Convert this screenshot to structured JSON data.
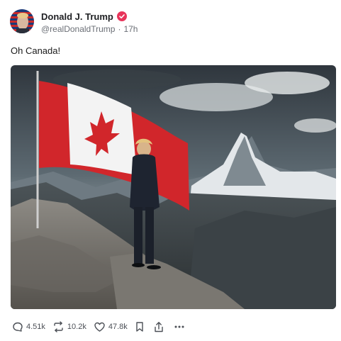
{
  "author": {
    "name": "Donald J. Trump",
    "handle": "@realDonaldTrump",
    "separator": "·",
    "time": "17h",
    "verified_color": "#e8345a"
  },
  "post": {
    "text": "Oh Canada!"
  },
  "image": {
    "description_icon": "photo"
  },
  "actions": {
    "replies": "4.51k",
    "reposts": "10.2k",
    "likes": "47.8k",
    "bookmark_icon": "bookmark-icon",
    "share_icon": "share-icon",
    "more_icon": "more-icon"
  }
}
